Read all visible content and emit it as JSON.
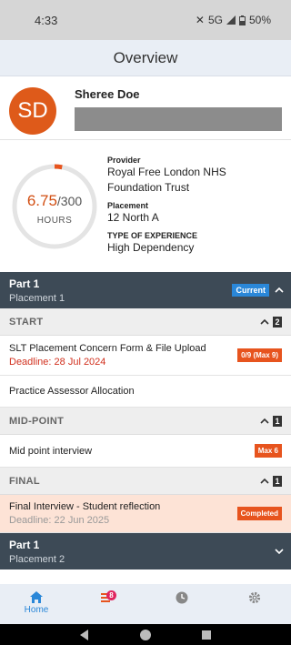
{
  "status": {
    "time": "4:33",
    "network": "5G",
    "battery": "50%"
  },
  "header": {
    "title": "Overview"
  },
  "profile": {
    "initials": "SD",
    "name": "Sheree Doe"
  },
  "hours": {
    "value": "6.75",
    "total": "/300",
    "label": "HOURS",
    "progress": 0.0225
  },
  "details": {
    "provider_label": "Provider",
    "provider": "Royal Free London NHS Foundation Trust",
    "placement_label": "Placement",
    "placement": "12 North A",
    "experience_label": "TYPE OF EXPERIENCE",
    "experience": "High Dependency"
  },
  "part1": {
    "title": "Part 1",
    "subtitle": "Placement 1",
    "badge": "Current"
  },
  "sections": {
    "start": {
      "label": "START",
      "count": "2"
    },
    "mid": {
      "label": "MID-POINT",
      "count": "1"
    },
    "final": {
      "label": "FINAL",
      "count": "1"
    }
  },
  "tasks": {
    "slt": {
      "title": "SLT Placement Concern Form & File Upload",
      "deadline": "Deadline: 28 Jul 2024",
      "tag": "0/9 (Max 9)"
    },
    "assessor": {
      "title": "Practice Assessor Allocation"
    },
    "mid": {
      "title": "Mid point interview",
      "tag": "Max 6"
    },
    "final": {
      "title": "Final Interview - Student reflection",
      "deadline": "Deadline: 22 Jun 2025",
      "tag": "Completed"
    }
  },
  "part2": {
    "title": "Part 1",
    "subtitle": "Placement 2"
  },
  "nav": {
    "home": "Home",
    "notifications_badge": "8"
  },
  "colors": {
    "accent": "#2a87d8",
    "orange": "#e7541e",
    "dark": "#3d4a56"
  }
}
